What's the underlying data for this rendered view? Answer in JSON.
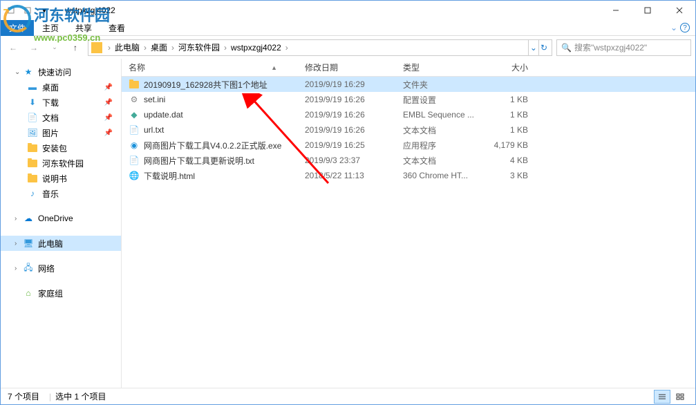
{
  "window": {
    "title": "wstpxzgj4022"
  },
  "ribbon": {
    "file": "文件",
    "home": "主页",
    "share": "共享",
    "view": "查看"
  },
  "breadcrumb": {
    "root": "此电脑",
    "desktop": "桌面",
    "folder1": "河东软件园",
    "folder2": "wstpxzgj4022"
  },
  "search": {
    "placeholder": "搜索\"wstpxzgj4022\""
  },
  "sidebar": {
    "quickaccess": "快速访问",
    "desktop": "桌面",
    "downloads": "下载",
    "documents": "文档",
    "pictures": "图片",
    "pkg": "安装包",
    "hedong": "河东软件园",
    "manual": "说明书",
    "music": "音乐",
    "onedrive": "OneDrive",
    "thispc": "此电脑",
    "network": "网络",
    "homegroup": "家庭组"
  },
  "columns": {
    "name": "名称",
    "date": "修改日期",
    "type": "类型",
    "size": "大小"
  },
  "files": [
    {
      "name": "20190919_162928共下图1个地址",
      "date": "2019/9/19 16:29",
      "type": "文件夹",
      "size": "",
      "icon": "folder"
    },
    {
      "name": "set.ini",
      "date": "2019/9/19 16:26",
      "type": "配置设置",
      "size": "1 KB",
      "icon": "ini"
    },
    {
      "name": "update.dat",
      "date": "2019/9/19 16:26",
      "type": "EMBL Sequence ...",
      "size": "1 KB",
      "icon": "dat"
    },
    {
      "name": "url.txt",
      "date": "2019/9/19 16:26",
      "type": "文本文档",
      "size": "1 KB",
      "icon": "txt"
    },
    {
      "name": "网商图片下载工具V4.0.2.2正式版.exe",
      "date": "2019/9/19 16:25",
      "type": "应用程序",
      "size": "4,179 KB",
      "icon": "exe"
    },
    {
      "name": "网商图片下载工具更新说明.txt",
      "date": "2019/9/3 23:37",
      "type": "文本文档",
      "size": "4 KB",
      "icon": "txt"
    },
    {
      "name": "下载说明.html",
      "date": "2018/5/22 11:13",
      "type": "360 Chrome HT...",
      "size": "3 KB",
      "icon": "html"
    }
  ],
  "status": {
    "count": "7 个项目",
    "selected": "选中 1 个项目"
  },
  "watermark": {
    "text": "河东软件园",
    "url": "www.pc0359.cn"
  }
}
